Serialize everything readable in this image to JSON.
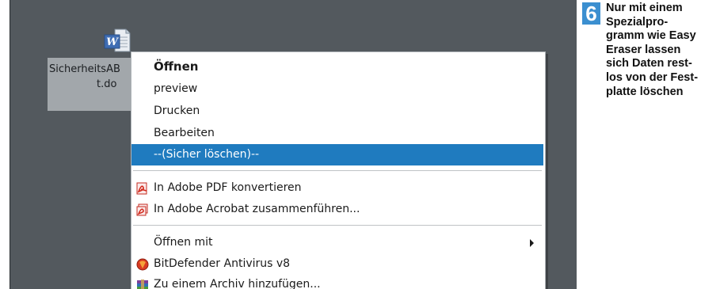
{
  "desktop_icon": {
    "icon": "word-document-icon",
    "label_line1": "SicherheitsAB",
    "label_line2": "t.do"
  },
  "context_menu": {
    "items": [
      {
        "label": "Öffnen",
        "bold": true
      },
      {
        "label": "preview"
      },
      {
        "label": "Drucken"
      },
      {
        "label": "Bearbeiten"
      },
      {
        "label": "--(Sicher löschen)--",
        "selected": true
      },
      {
        "label": "In Adobe PDF konvertieren",
        "icon": "adobe-pdf-icon"
      },
      {
        "label": "In Adobe Acrobat zusammenführen...",
        "icon": "adobe-acrobat-icon"
      },
      {
        "label": "Öffnen mit",
        "submenu": true
      },
      {
        "label": "BitDefender Antivirus v8",
        "icon": "bitdefender-icon"
      },
      {
        "label": "Zu einem Archiv hinzufügen...",
        "icon": "winrar-archive-icon"
      }
    ]
  },
  "caption": {
    "number": "6",
    "lines": [
      "Nur mit einem",
      "Spezialpro-",
      "gramm wie Easy",
      "Eraser lassen",
      "sich Daten rest-",
      "los von der Fest-",
      "platte löschen"
    ]
  },
  "colors": {
    "desktop": "#53595e",
    "selection": "#1f7bbf",
    "badge": "#3b8fd0"
  }
}
